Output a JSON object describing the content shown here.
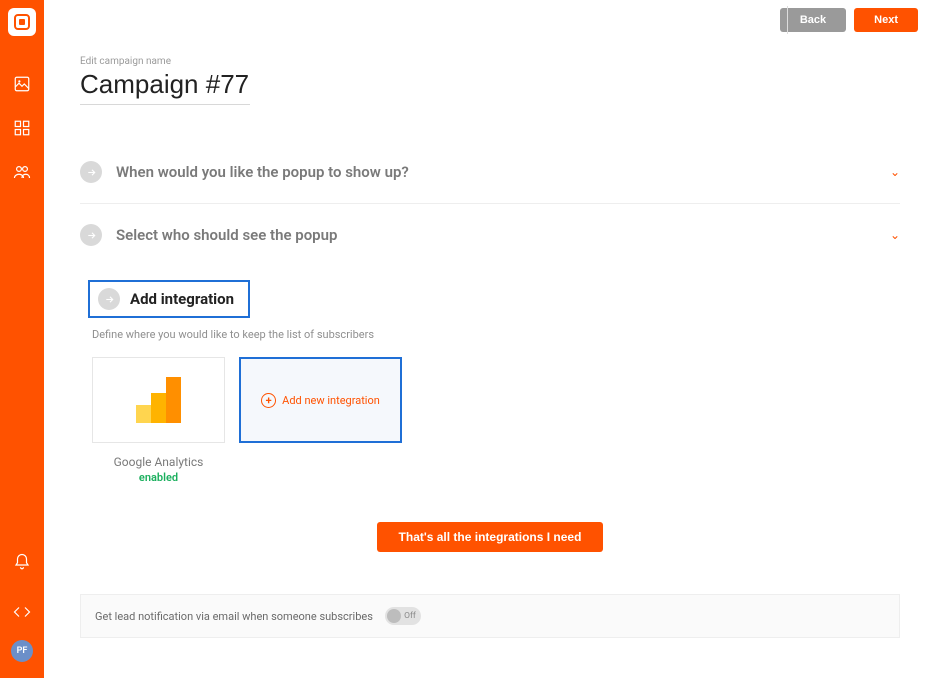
{
  "topbar": {
    "back": "Back",
    "next": "Next"
  },
  "sidebar": {
    "avatar": "PF"
  },
  "page": {
    "edit_label": "Edit campaign name",
    "title": "Campaign #77"
  },
  "sections": {
    "when": "When would you like the popup to show up?",
    "who": "Select who should see the popup"
  },
  "integration": {
    "header": "Add integration",
    "sub": "Define where you would like to keep the list of subscribers",
    "ga_name": "Google Analytics",
    "ga_status": "enabled",
    "add_new": "Add new integration",
    "done": "That's all the integrations I need"
  },
  "notif": {
    "text": "Get lead notification via email when someone subscribes",
    "toggle": "Off"
  }
}
